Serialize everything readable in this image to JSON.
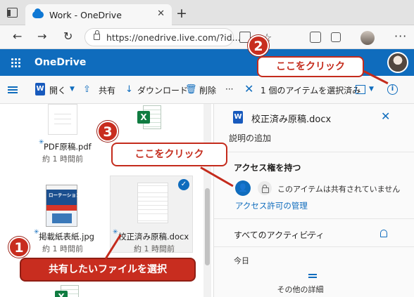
{
  "browser": {
    "tab_title": "Work - OneDrive",
    "tab_close": "✕",
    "new_tab": "+",
    "nav_back": "←",
    "nav_forward": "→",
    "nav_reload": "↻",
    "url": "https://onedrive.live.com/?id...",
    "more": "···"
  },
  "header": {
    "brand": "OneDrive"
  },
  "commandbar": {
    "open": "開く",
    "share": "共有",
    "download": "ダウンロード",
    "delete": "削除",
    "more": "···",
    "selected": "1 個のアイテムを選択済み",
    "clear_icon": "✕"
  },
  "files": [
    {
      "name": "PDF原稿.pdf",
      "time": "約 1 時間前"
    },
    {
      "name": "掲載紙表紙.jpg",
      "time": "約 1 時間前"
    },
    {
      "name": "校正済み原稿.docx",
      "time": "約 1 時間前",
      "selected": true
    }
  ],
  "excel_badge": "X",
  "book_cover_title": "ローテーションマップ",
  "details": {
    "title": "校正済み原稿.docx",
    "close": "✕",
    "add_description": "説明の追加",
    "access_title": "アクセス権を持つ",
    "shared_status": "このアイテムは共有されていません",
    "manage_access": "アクセス許可の管理",
    "activity_title": "すべてのアクティビティ",
    "today": "今日",
    "more_details": "その他の詳細"
  },
  "callouts": {
    "step1": {
      "number": "1",
      "text": "共有したいファイルを選択"
    },
    "step2": {
      "number": "2",
      "text": "ここをクリック"
    },
    "step3": {
      "number": "3",
      "text": "ここをクリック"
    }
  },
  "colors": {
    "accent": "#0f6cbd",
    "callout_red": "#c82d1f",
    "excel_green": "#107c41",
    "word_blue": "#185abd"
  }
}
